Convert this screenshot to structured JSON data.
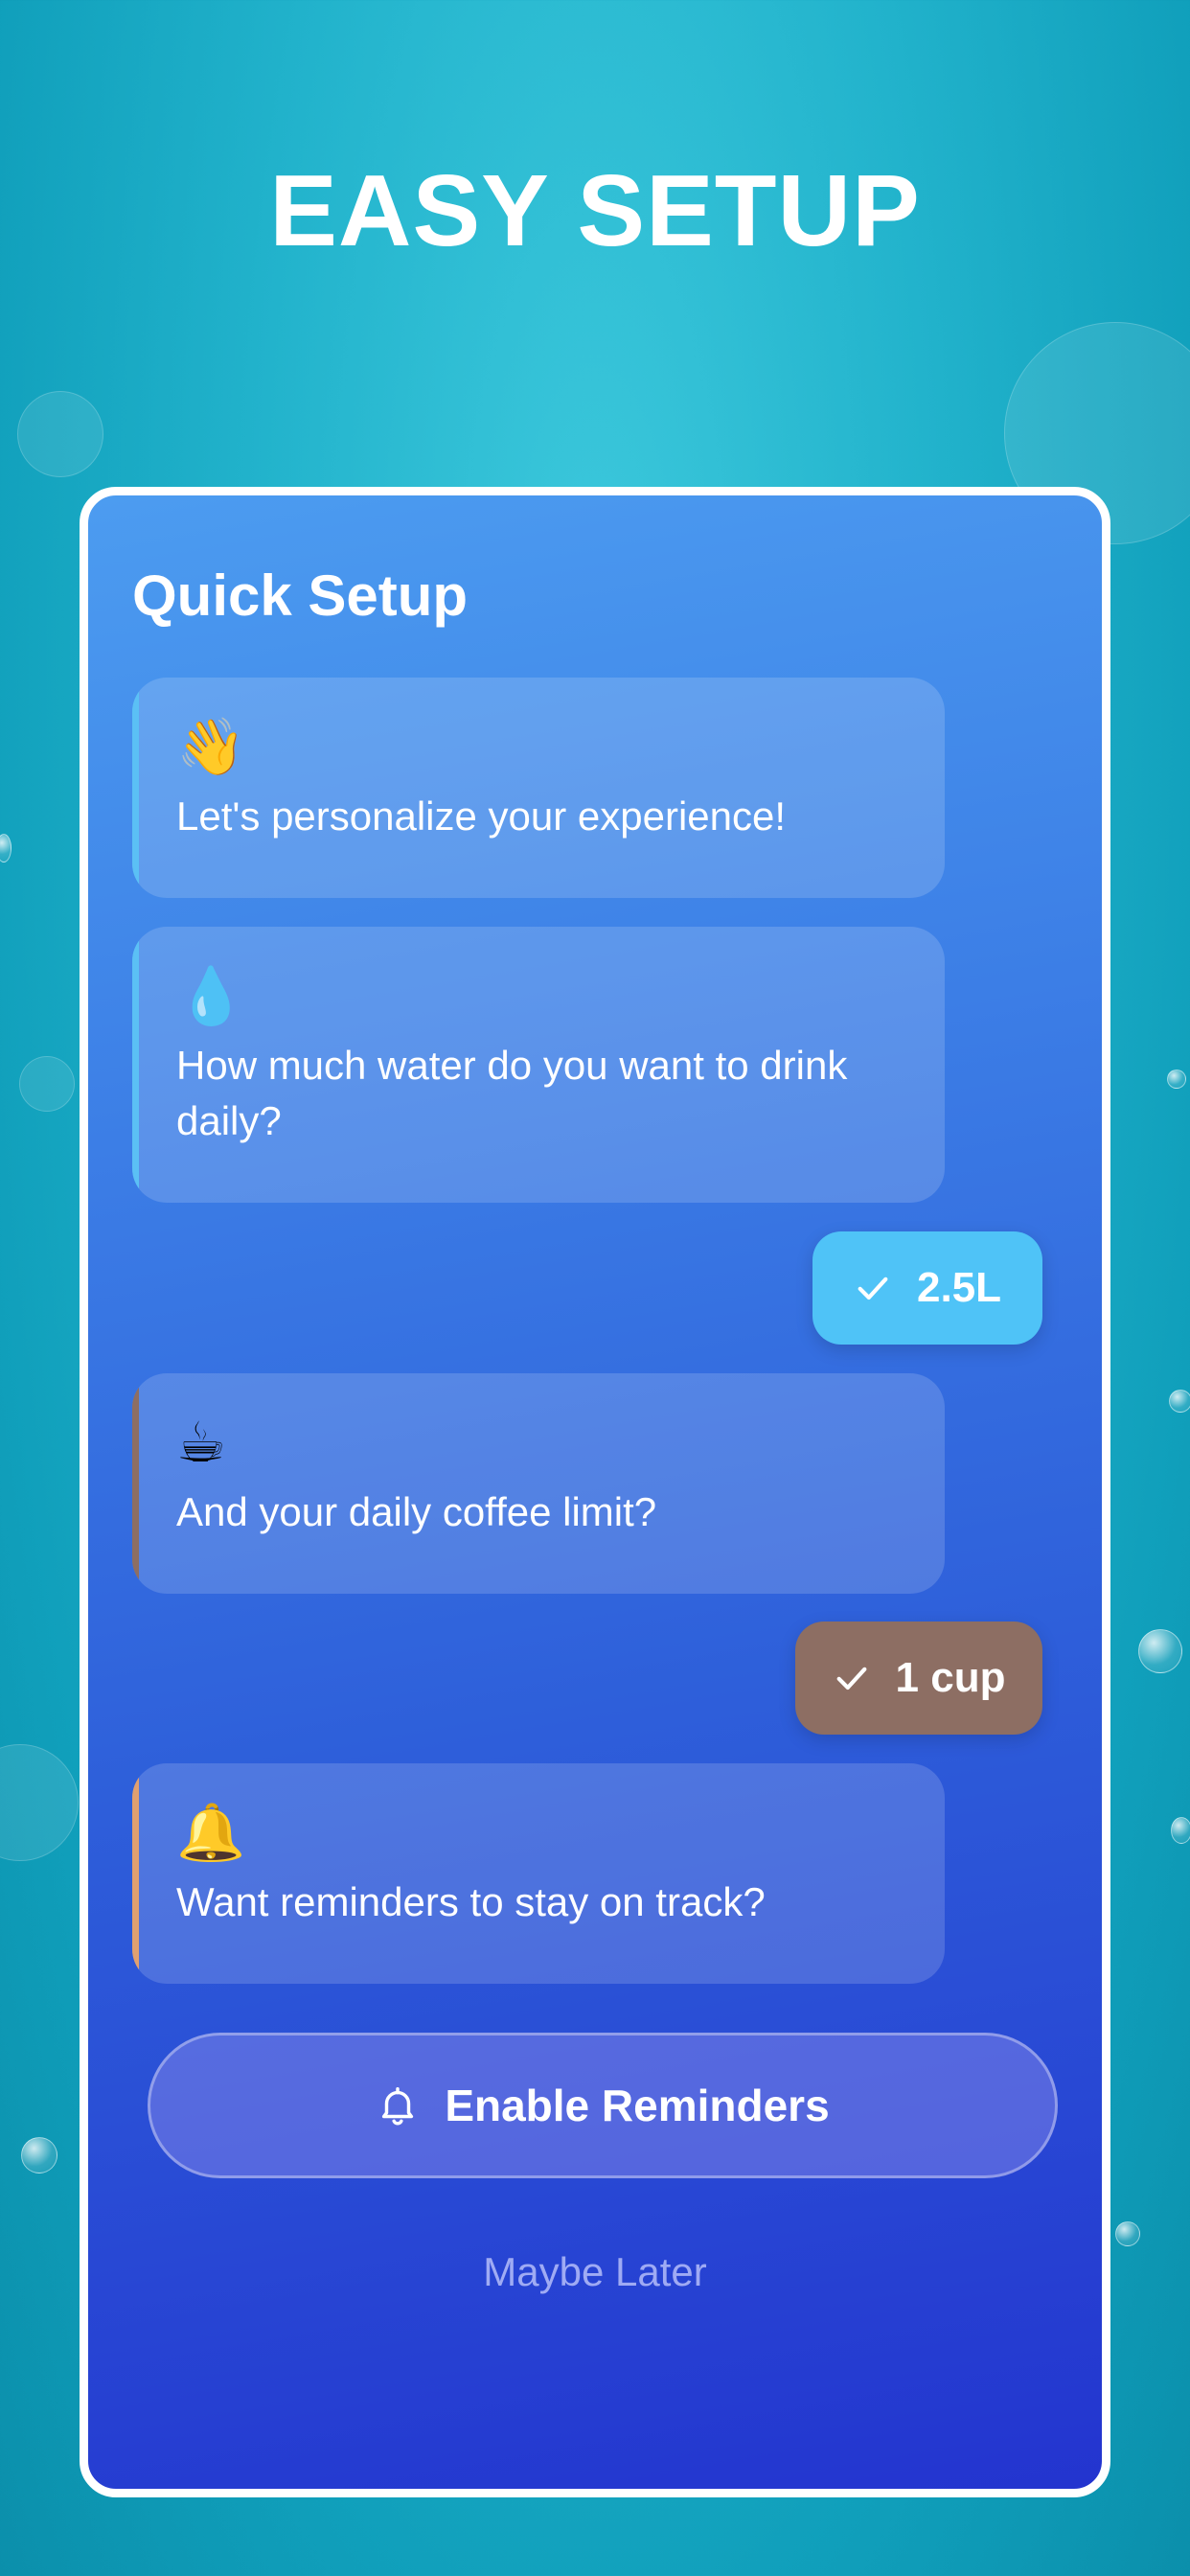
{
  "headline": "EASY SETUP",
  "card": {
    "title": "Quick Setup",
    "messages": [
      {
        "emoji": "👋",
        "text": "Let's personalize your experience!",
        "accent": "#5bc0f5"
      },
      {
        "emoji": "💧",
        "text": "How much water do you want to drink daily?",
        "accent": "#5bc0f5"
      },
      {
        "emoji": "☕",
        "text": "And your daily coffee limit?",
        "accent": "#8d6e63"
      },
      {
        "emoji": "🔔",
        "text": "Want reminders to stay on track?",
        "accent": "#e0a070"
      }
    ],
    "answers": [
      {
        "text": "2.5L",
        "color": "#4fc3f7"
      },
      {
        "text": "1 cup",
        "color": "#8d6e63"
      }
    ],
    "enable_button": "Enable Reminders",
    "later_link": "Maybe Later"
  },
  "icons": {
    "check": "check-icon",
    "bell": "bell-icon"
  }
}
